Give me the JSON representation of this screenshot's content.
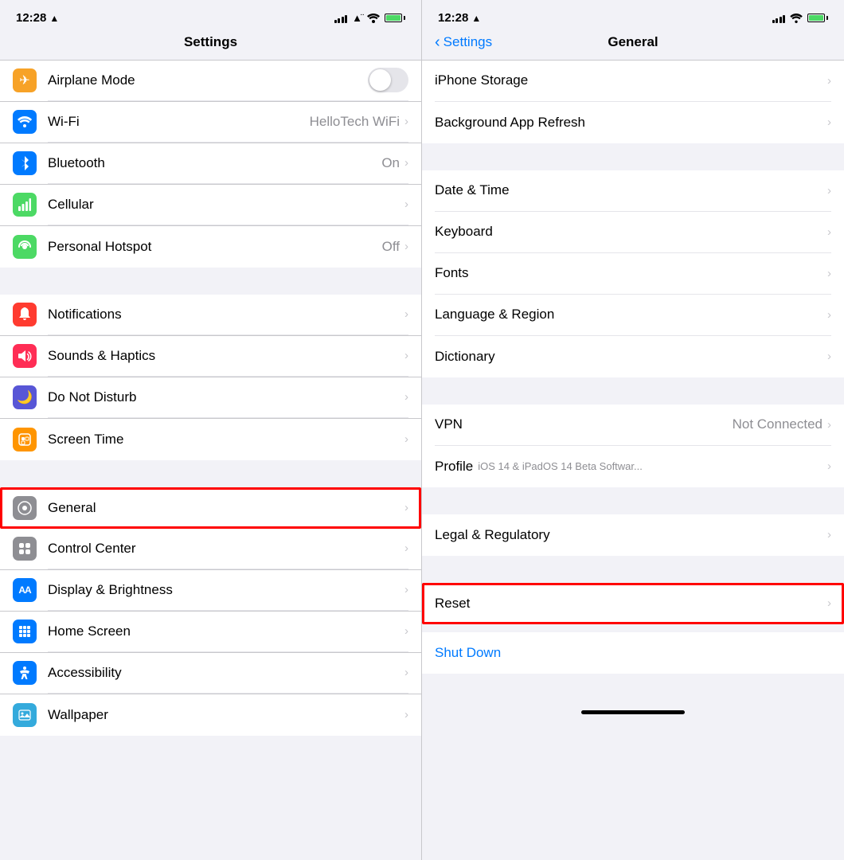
{
  "left": {
    "status": {
      "time": "12:28",
      "location": "▲"
    },
    "title": "Settings",
    "groups": [
      {
        "items": [
          {
            "id": "airplane",
            "label": "Airplane Mode",
            "icon": "✈",
            "iconBg": "#f7a227",
            "hasToggle": true,
            "toggleOn": false,
            "value": "",
            "chevron": false
          },
          {
            "id": "wifi",
            "label": "Wi-Fi",
            "icon": "📶",
            "iconBg": "#007aff",
            "hasToggle": false,
            "value": "HelloTech WiFi",
            "chevron": true
          },
          {
            "id": "bluetooth",
            "label": "Bluetooth",
            "icon": "⬡",
            "iconBg": "#007aff",
            "hasToggle": false,
            "value": "On",
            "chevron": true
          },
          {
            "id": "cellular",
            "label": "Cellular",
            "icon": "📡",
            "iconBg": "#4cd964",
            "hasToggle": false,
            "value": "",
            "chevron": true
          },
          {
            "id": "hotspot",
            "label": "Personal Hotspot",
            "icon": "∞",
            "iconBg": "#4cd964",
            "hasToggle": false,
            "value": "Off",
            "chevron": true
          }
        ]
      },
      {
        "items": [
          {
            "id": "notifications",
            "label": "Notifications",
            "icon": "🔔",
            "iconBg": "#ff3b30",
            "hasToggle": false,
            "value": "",
            "chevron": true
          },
          {
            "id": "sounds",
            "label": "Sounds & Haptics",
            "icon": "🔊",
            "iconBg": "#ff2d55",
            "hasToggle": false,
            "value": "",
            "chevron": true
          },
          {
            "id": "donotdisturb",
            "label": "Do Not Disturb",
            "icon": "🌙",
            "iconBg": "#5856d6",
            "hasToggle": false,
            "value": "",
            "chevron": true
          },
          {
            "id": "screentime",
            "label": "Screen Time",
            "icon": "⏳",
            "iconBg": "#ff9500",
            "hasToggle": false,
            "value": "",
            "chevron": true
          }
        ]
      },
      {
        "items": [
          {
            "id": "general",
            "label": "General",
            "icon": "⚙",
            "iconBg": "#8e8e93",
            "hasToggle": false,
            "value": "",
            "chevron": true,
            "highlight": true
          },
          {
            "id": "controlcenter",
            "label": "Control Center",
            "icon": "⊞",
            "iconBg": "#8e8e93",
            "hasToggle": false,
            "value": "",
            "chevron": true
          },
          {
            "id": "displaybrightness",
            "label": "Display & Brightness",
            "icon": "AA",
            "iconBg": "#007aff",
            "hasToggle": false,
            "value": "",
            "chevron": true
          },
          {
            "id": "homescreen",
            "label": "Home Screen",
            "icon": "⊞",
            "iconBg": "#007aff",
            "hasToggle": false,
            "value": "",
            "chevron": true
          },
          {
            "id": "accessibility",
            "label": "Accessibility",
            "icon": "♿",
            "iconBg": "#007aff",
            "hasToggle": false,
            "value": "",
            "chevron": true
          },
          {
            "id": "wallpaper",
            "label": "Wallpaper",
            "icon": "🖼",
            "iconBg": "#34aadc",
            "hasToggle": false,
            "value": "",
            "chevron": true
          }
        ]
      }
    ]
  },
  "right": {
    "status": {
      "time": "12:28",
      "location": "▲"
    },
    "backLabel": "Settings",
    "title": "General",
    "groups": [
      {
        "items": [
          {
            "id": "iphonestorage",
            "label": "iPhone Storage",
            "value": "",
            "chevron": true
          },
          {
            "id": "backgroundapprefresh",
            "label": "Background App Refresh",
            "value": "",
            "chevron": true
          }
        ]
      },
      {
        "items": [
          {
            "id": "datetime",
            "label": "Date & Time",
            "value": "",
            "chevron": true
          },
          {
            "id": "keyboard",
            "label": "Keyboard",
            "value": "",
            "chevron": true
          },
          {
            "id": "fonts",
            "label": "Fonts",
            "value": "",
            "chevron": true
          },
          {
            "id": "languageregion",
            "label": "Language & Region",
            "value": "",
            "chevron": true
          },
          {
            "id": "dictionary",
            "label": "Dictionary",
            "value": "",
            "chevron": true
          }
        ]
      },
      {
        "items": [
          {
            "id": "vpn",
            "label": "VPN",
            "value": "Not Connected",
            "chevron": true
          },
          {
            "id": "profile",
            "label": "Profile",
            "sublabel": "iOS 14 & iPadOS 14 Beta Softwar...",
            "value": "",
            "chevron": true
          }
        ]
      },
      {
        "items": [
          {
            "id": "legalregulatory",
            "label": "Legal & Regulatory",
            "value": "",
            "chevron": true
          }
        ]
      },
      {
        "items": [
          {
            "id": "reset",
            "label": "Reset",
            "value": "",
            "chevron": true,
            "highlight": true
          }
        ]
      },
      {
        "items": [
          {
            "id": "shutdown",
            "label": "Shut Down",
            "isBlue": true,
            "value": "",
            "chevron": false
          }
        ]
      }
    ]
  }
}
